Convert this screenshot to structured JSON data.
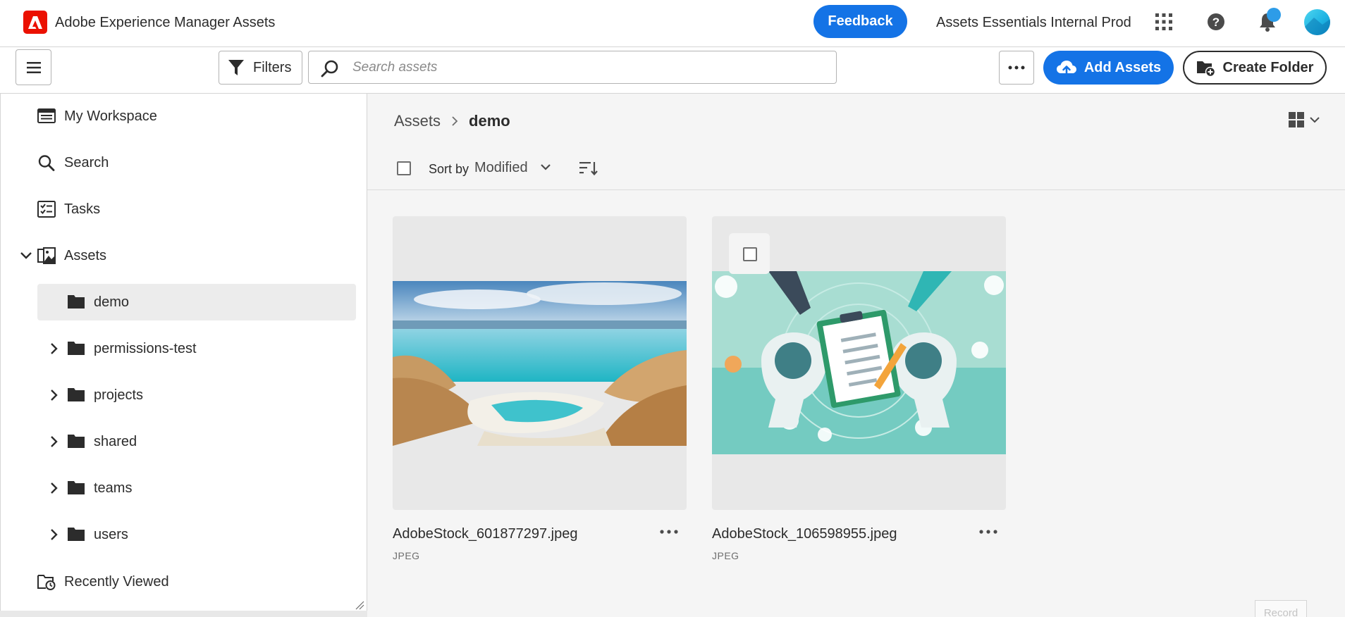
{
  "header": {
    "app_title": "Adobe Experience Manager Assets",
    "feedback_label": "Feedback",
    "org_name": "Assets Essentials Internal Prod",
    "brand_color": "#eb1000",
    "accent_color": "#1473e6",
    "icons": [
      "adobe-logo-icon",
      "apps-grid-icon",
      "help-icon",
      "bell-icon",
      "avatar"
    ]
  },
  "toolbar": {
    "filters_label": "Filters",
    "search_placeholder": "Search assets",
    "search_value": "",
    "add_assets_label": "Add Assets",
    "create_folder_label": "Create Folder"
  },
  "sidebar": {
    "items": [
      {
        "label": "My Workspace",
        "icon": "workspace-icon"
      },
      {
        "label": "Search",
        "icon": "search-icon"
      },
      {
        "label": "Tasks",
        "icon": "tasks-icon"
      },
      {
        "label": "Assets",
        "icon": "assets-icon",
        "expanded": true
      },
      {
        "label": "Recently Viewed",
        "icon": "recent-icon"
      }
    ],
    "folders": [
      {
        "label": "demo",
        "selected": true
      },
      {
        "label": "permissions-test"
      },
      {
        "label": "projects"
      },
      {
        "label": "shared"
      },
      {
        "label": "teams"
      },
      {
        "label": "users"
      }
    ]
  },
  "main": {
    "breadcrumb": {
      "root": "Assets",
      "current": "demo"
    },
    "sort": {
      "label": "Sort by",
      "value": "Modified"
    },
    "view_mode": "grid",
    "cards": [
      {
        "name": "AdobeStock_601877297.jpeg",
        "type": "JPEG"
      },
      {
        "name": "AdobeStock_106598955.jpeg",
        "type": "JPEG"
      }
    ]
  },
  "footer": {
    "record_label": "Record"
  }
}
